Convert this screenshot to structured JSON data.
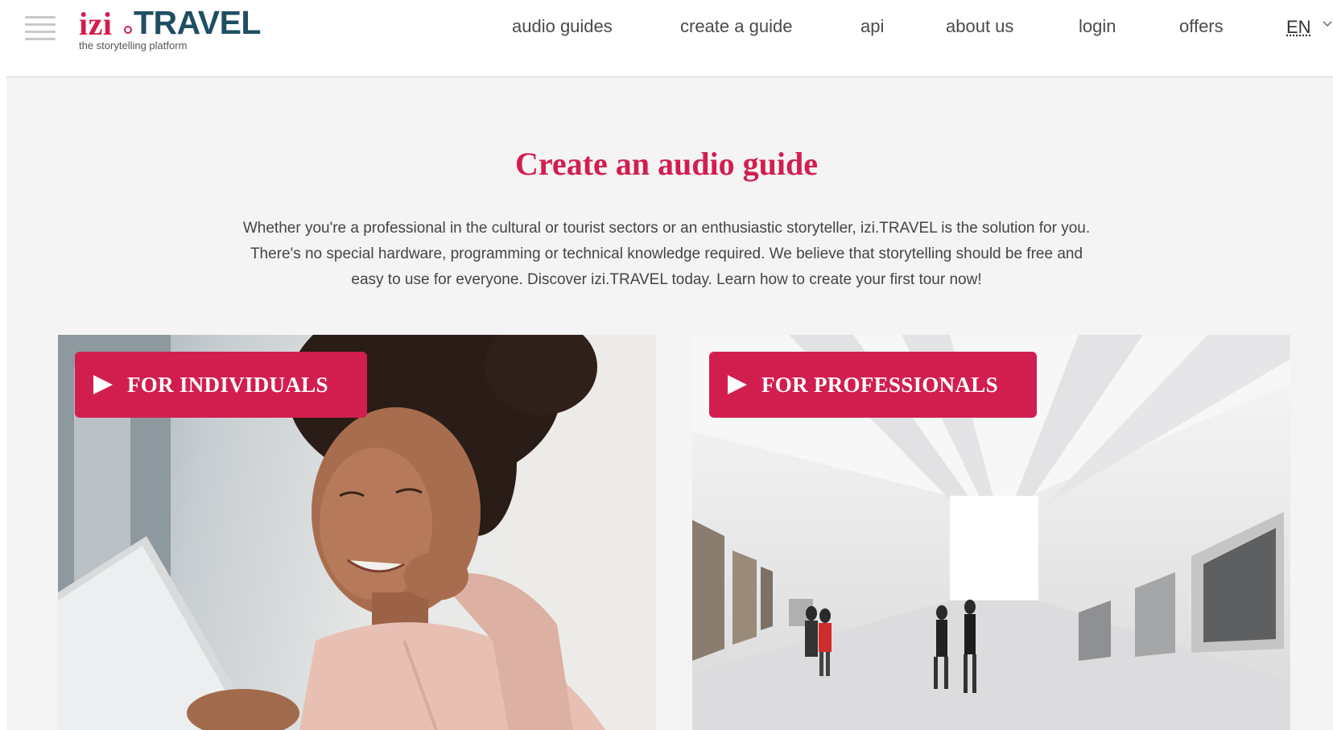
{
  "logo": {
    "brand_prefix": "izi",
    "brand_name": "TRAVEL",
    "tagline": "the storytelling platform"
  },
  "nav": {
    "items": [
      {
        "label": "audio guides"
      },
      {
        "label": "create a guide"
      },
      {
        "label": "api"
      },
      {
        "label": "about us"
      },
      {
        "label": "login"
      },
      {
        "label": "offers"
      }
    ],
    "language": "EN"
  },
  "main": {
    "title": "Create an audio guide",
    "description": "Whether you're a professional in the cultural or tourist sectors or an enthusiastic storyteller, izi.TRAVEL is the solution for you. There's no special hardware, programming or technical knowledge required. We believe that storytelling should be free and easy to use for everyone. Discover izi.TRAVEL today. Learn how to create your first tour now!",
    "cards": [
      {
        "label": "FOR INDIVIDUALS",
        "image": "woman-with-laptop-photo"
      },
      {
        "label": "FOR PROFESSIONALS",
        "image": "art-gallery-photo"
      }
    ]
  },
  "colors": {
    "accent": "#d21e4f",
    "brand_dark": "#1f4e63",
    "background": "#f4f4f4"
  }
}
